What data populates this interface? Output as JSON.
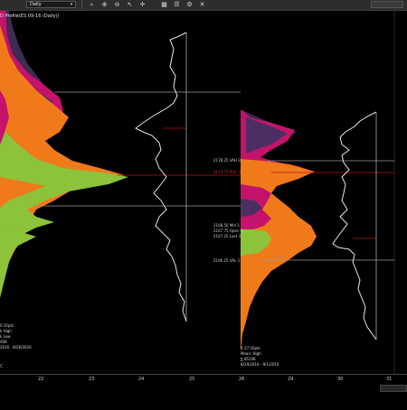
{
  "window": {
    "title": "D Profile(ES 09-16 (Daily))",
    "period": "Daily"
  },
  "toolbar": {
    "icons": [
      "magnifier-icon",
      "zoom-in-icon",
      "zoom-out-icon",
      "pointer-icon",
      "crosshair-icon",
      "grid-icon",
      "gear-icon",
      "close-icon"
    ]
  },
  "profile_left": {
    "levels": [],
    "stats": [
      "0.35pts",
      "k High",
      "k Low",
      "40K",
      "2016 - 8/26/2016"
    ]
  },
  "profile_right": {
    "levels": [
      {
        "label": "2178.25 VAH 3",
        "color": "gray"
      },
      {
        "label": "2174.75 POC 3",
        "color": "red"
      },
      {
        "label": "2168.50 Mid 3",
        "color": "gray"
      },
      {
        "label": "2167.75 Open 3",
        "color": "gray"
      },
      {
        "label": "2167.25 Last 3",
        "color": "gray"
      },
      {
        "label": "2166.25 VAL 3",
        "color": "gray"
      }
    ],
    "stats": [
      "R 27.50pts",
      "Mean: High",
      "∑ 8510K",
      "8/29/2016 - 9/1/2016"
    ]
  },
  "xaxis": {
    "ticks": [
      "22",
      "23",
      "24",
      "25",
      "26",
      "29",
      "30",
      "31"
    ],
    "left_edge": "C"
  },
  "colors": {
    "background": "#000000",
    "orange": "#f07a1a",
    "lime": "#8cc23a",
    "magenta": "#c4126a",
    "purple": "#4a2a5a",
    "poc_line": "#c01010",
    "value_line": "#9a9a9a",
    "curve": "#e8e8e8"
  }
}
